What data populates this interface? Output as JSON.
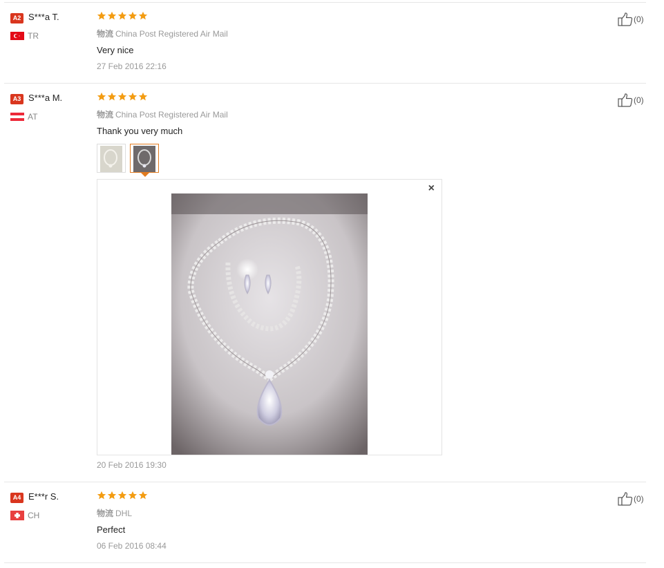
{
  "colors": {
    "star": "#f39c12",
    "badge": "#d9361e",
    "active_thumb_border": "#e27b1f"
  },
  "reviews": [
    {
      "level": "A2",
      "user": "S***a T.",
      "country_code": "TR",
      "flag_icon": "turkey-flag-icon",
      "rating": 5,
      "shipping_label": "物流",
      "shipping_method": "China Post Registered Air Mail",
      "comment": "Very nice",
      "date": "27 Feb 2016 22:16",
      "helpful_count": "(0)"
    },
    {
      "level": "A3",
      "user": "S***a M.",
      "country_code": "AT",
      "flag_icon": "austria-flag-icon",
      "rating": 5,
      "shipping_label": "物流",
      "shipping_method": "China Post Registered Air Mail",
      "comment": "Thank you very much",
      "date": "20 Feb 2016 19:30",
      "helpful_count": "(0)",
      "photos": [
        "necklace-photo-thumbnail",
        "jewelry-set-photo-thumbnail"
      ],
      "selected_photo": 2,
      "viewer_close_label": "×"
    },
    {
      "level": "A4",
      "user": "E***r S.",
      "country_code": "CH",
      "flag_icon": "switzerland-flag-icon",
      "rating": 5,
      "shipping_label": "物流",
      "shipping_method": "DHL",
      "comment": "Perfect",
      "date": "06 Feb 2016 08:44",
      "helpful_count": "(0)"
    }
  ]
}
